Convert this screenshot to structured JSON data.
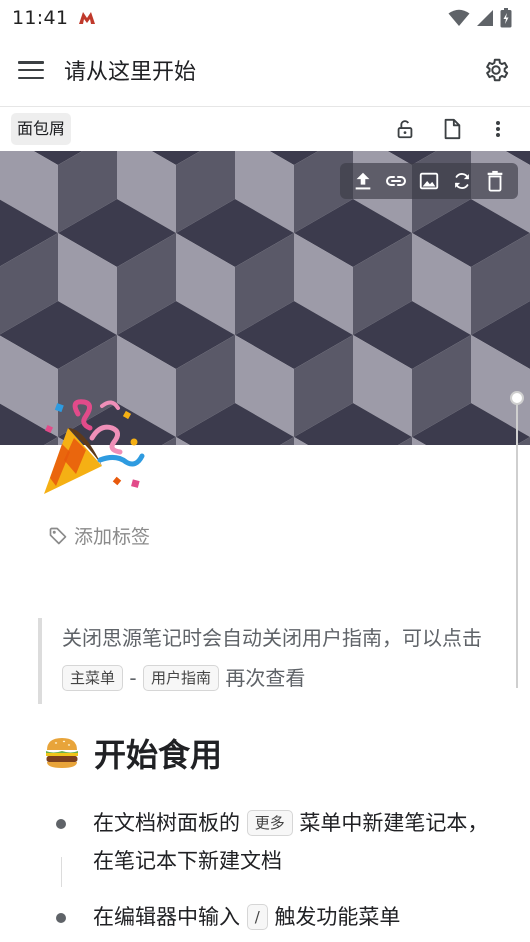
{
  "status_bar": {
    "time": "11:41",
    "icons": [
      "app-notification-icon",
      "wifi-icon",
      "signal-icon",
      "battery-icon"
    ]
  },
  "top_bar": {
    "title": "请从这里开始",
    "icons": [
      "menu-icon",
      "settings-icon"
    ]
  },
  "toolbar": {
    "breadcrumb": "面包屑",
    "icons": [
      "unlock-icon",
      "document-icon",
      "more-vertical-icon"
    ]
  },
  "banner": {
    "colors": {
      "dark": "#3c3b4d",
      "mid": "#5a5968",
      "light": "#9d9ba8"
    },
    "tools": [
      "upload-icon",
      "link-icon",
      "image-icon",
      "refresh-icon",
      "delete-icon"
    ]
  },
  "document": {
    "icon": "party-popper-emoji",
    "add_tag_label": "添加标签",
    "quote": {
      "text_before": "关闭思源笔记时会自动关闭用户指南，可以点击",
      "kbd_main_menu": "主菜单",
      "separator": "-",
      "kbd_user_guide": "用户指南",
      "text_after": "再次查看"
    },
    "heading": {
      "emoji": "hamburger-emoji",
      "text": "开始食用"
    },
    "list": [
      {
        "before": "在文档树面板的",
        "kbd": "更多",
        "after": "菜单中新建笔记本，在笔记本下新建文档"
      },
      {
        "before": "在编辑器中输入",
        "kbd": "/",
        "after": "触发功能菜单"
      }
    ]
  }
}
